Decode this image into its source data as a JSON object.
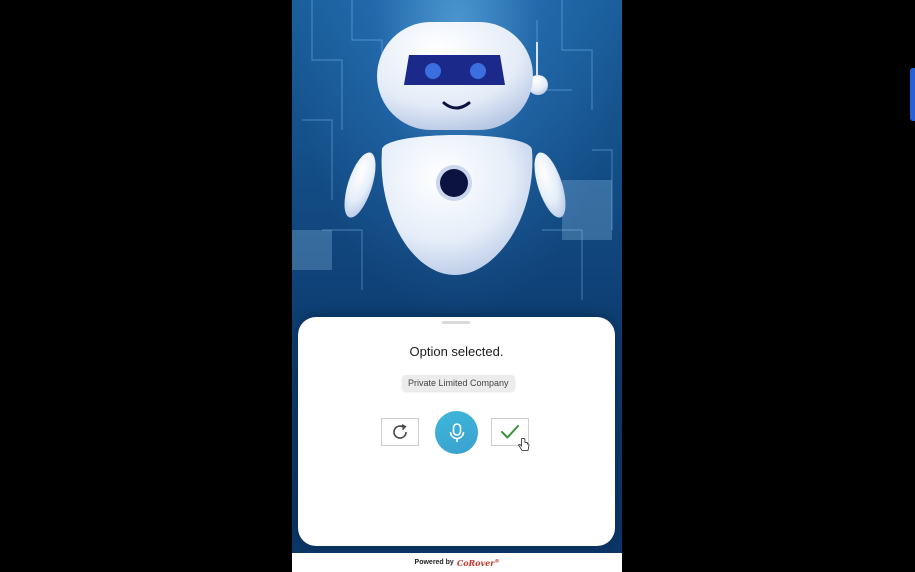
{
  "status": {
    "text": "Option selected."
  },
  "selection": {
    "chip": "Private Limited Company"
  },
  "controls": {
    "retry_icon": "refresh-icon",
    "mic_icon": "microphone-icon",
    "confirm_icon": "checkmark-icon"
  },
  "footer": {
    "label": "Powered by",
    "brand": "CoRover",
    "reg": "®"
  },
  "colors": {
    "mic_button": "#3aadd6",
    "checkmark": "#3a8f3a",
    "robot_visor": "#1b2a8a",
    "robot_eyes": "#3b6fe0",
    "side_tab": "#2a5fd8"
  }
}
